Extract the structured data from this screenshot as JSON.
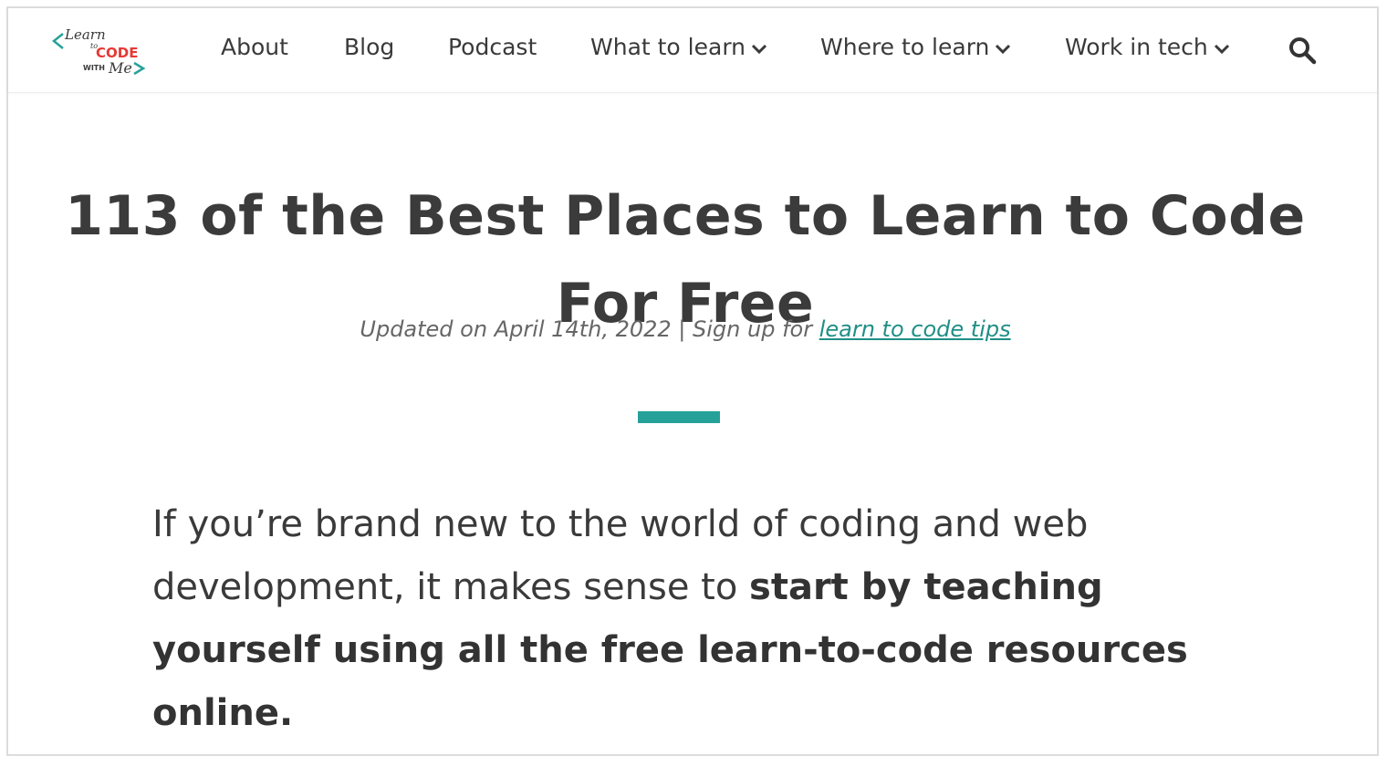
{
  "logo": {
    "line1": "Learn",
    "line2": "to",
    "line3": "CODE",
    "line4": "WITH",
    "line5": "Me",
    "accent_teal": "#26a199",
    "accent_red": "#e53935"
  },
  "nav": {
    "items": [
      {
        "label": "About",
        "has_dropdown": false
      },
      {
        "label": "Blog",
        "has_dropdown": false
      },
      {
        "label": "Podcast",
        "has_dropdown": false
      },
      {
        "label": "What to learn",
        "has_dropdown": true
      },
      {
        "label": "Where to learn",
        "has_dropdown": true
      },
      {
        "label": "Work in tech",
        "has_dropdown": true
      }
    ],
    "search_icon": "search-icon",
    "dropdown_icon": "chevron-down-icon"
  },
  "article": {
    "title": "113 of the Best Places to Learn to Code For Free",
    "meta_prefix": "Updated on April 14th, 2022 | Sign up for ",
    "meta_link": "learn to code tips",
    "intro_plain": "If you’re brand new to the world of coding and web development, it makes sense to ",
    "intro_bold": "start by teaching yourself using all the free learn-to-code resources online."
  },
  "colors": {
    "accent": "#26a199",
    "link": "#1f8f86",
    "text": "#3a3a3a"
  }
}
